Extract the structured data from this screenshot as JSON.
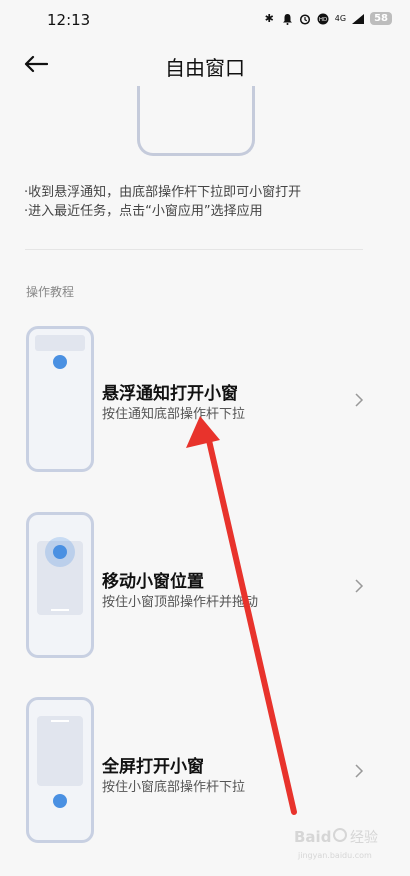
{
  "status": {
    "time": "12:13",
    "network": "4G",
    "battery": "58"
  },
  "header": {
    "title": "自由窗口"
  },
  "hints": [
    "·收到悬浮通知，由底部操作杆下拉即可小窗打开",
    "·进入最近任务，点击“小窗应用”选择应用"
  ],
  "section": {
    "label": "操作教程"
  },
  "tutorials": [
    {
      "title": "悬浮通知打开小窗",
      "subtitle": "按住通知底部操作杆下拉"
    },
    {
      "title": "移动小窗位置",
      "subtitle": "按住小窗顶部操作杆并拖动"
    },
    {
      "title": "全屏打开小窗",
      "subtitle": "按住小窗底部操作杆下拉"
    }
  ],
  "colors": {
    "accent_blue": "#4a90e2",
    "annotation_red": "#e8332c",
    "thumb_border": "#c8d0e2"
  },
  "icons": [
    "back-arrow-icon",
    "chevron-right-icon",
    "bluetooth-icon",
    "bell-icon",
    "alarm-icon",
    "hd-icon",
    "signal-icon",
    "battery-icon"
  ]
}
